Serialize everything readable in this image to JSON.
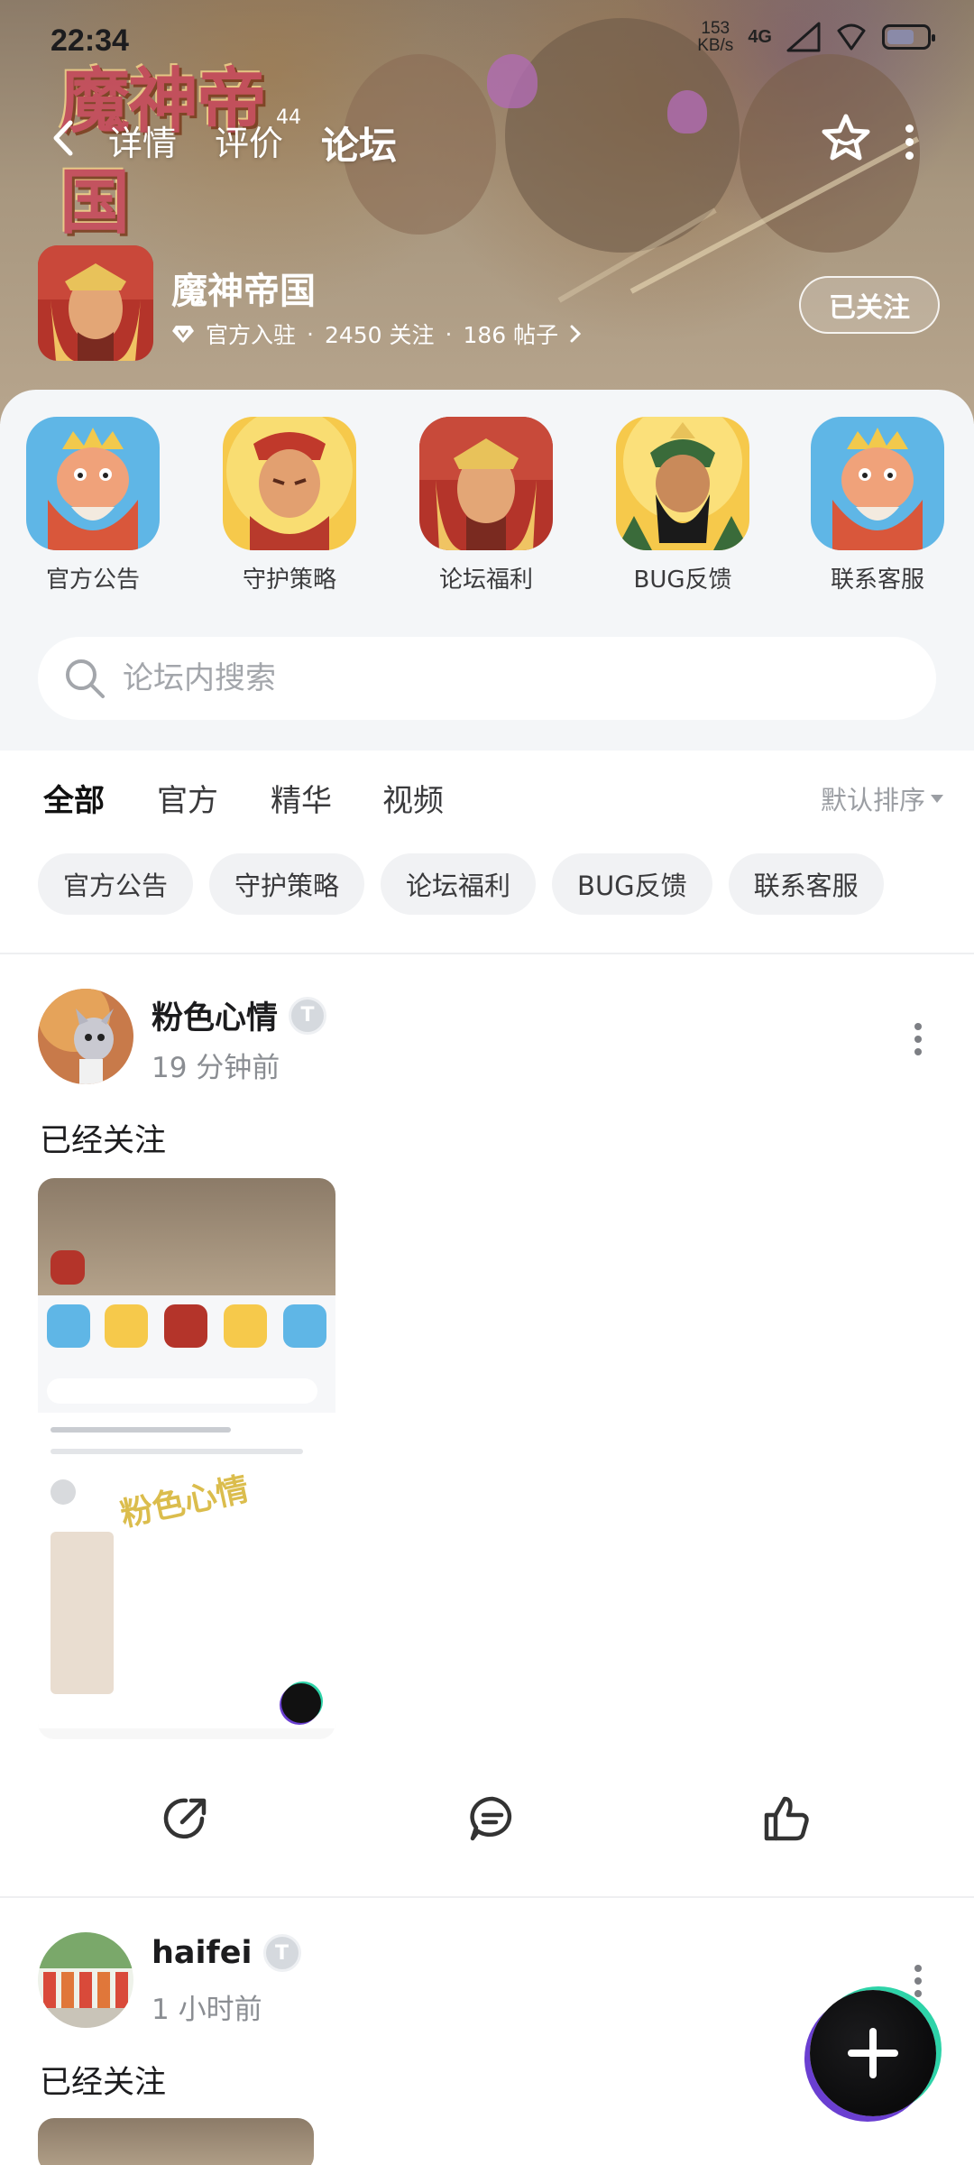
{
  "status_bar": {
    "time": "22:34",
    "net_speed_value": "153",
    "net_speed_unit": "KB/s",
    "signal": "4G",
    "battery_level": 0.7
  },
  "logo_text": "魔神帝国",
  "nav": {
    "tabs": [
      {
        "label": "详情"
      },
      {
        "label": "评价",
        "badge": "44"
      },
      {
        "label": "论坛"
      }
    ],
    "active_tab": "论坛"
  },
  "game": {
    "name": "魔神帝国",
    "official": "官方入驻",
    "followers": "2450 关注",
    "posts": "186 帖子",
    "follow_button": "已关注"
  },
  "categories": [
    {
      "label": "官方公告",
      "icon": "king-icon"
    },
    {
      "label": "守护策略",
      "icon": "warrior-icon"
    },
    {
      "label": "论坛福利",
      "icon": "hero-icon"
    },
    {
      "label": "BUG反馈",
      "icon": "general-icon"
    },
    {
      "label": "联系客服",
      "icon": "king-icon"
    }
  ],
  "search": {
    "placeholder": "论坛内搜索"
  },
  "filter_tabs": [
    {
      "label": "全部"
    },
    {
      "label": "官方"
    },
    {
      "label": "精华"
    },
    {
      "label": "视频"
    }
  ],
  "active_filter": "全部",
  "sort_label": "默认排序",
  "chips": [
    "官方公告",
    "守护策略",
    "论坛福利",
    "BUG反馈",
    "联系客服"
  ],
  "posts": [
    {
      "author": "粉色心情",
      "level": "T",
      "time": "19 分钟前",
      "text": "已经关注",
      "image_watermark": "粉色心情"
    },
    {
      "author": "haifei",
      "level": "T",
      "time": "1 小时前",
      "text": "已经关注"
    }
  ],
  "colors": {
    "accent": "#39d0a8",
    "header_bg": "#a8977f",
    "panel_bg": "#f4f6f8",
    "chip_bg": "#f1f2f4",
    "muted_text": "#8a8d92"
  }
}
